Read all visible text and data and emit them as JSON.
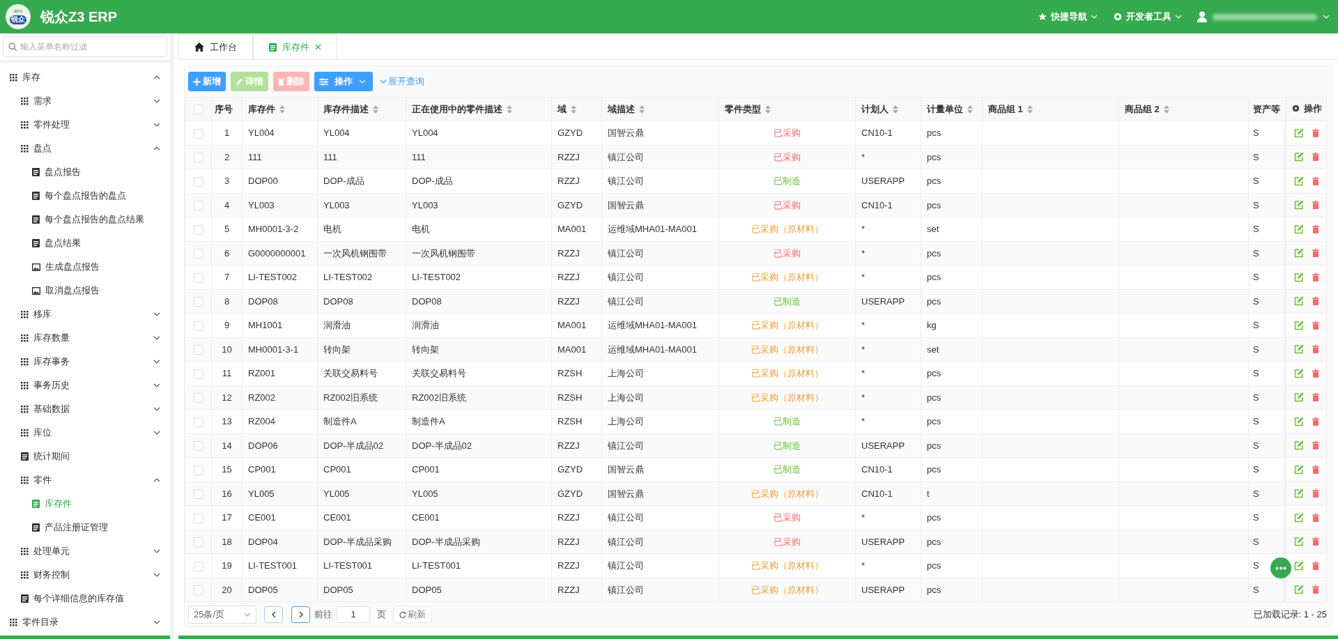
{
  "header": {
    "logo": {
      "top": "RES",
      "bottom": "锐众"
    },
    "title": "锐众Z3 ERP",
    "nav": [
      {
        "kind": "star",
        "label": "快捷导航"
      },
      {
        "kind": "gear",
        "label": "开发者工具"
      }
    ]
  },
  "sidebar": {
    "search": {
      "placeholder": "输入菜单名称过滤"
    },
    "items": [
      {
        "kind": "group",
        "label": "库存",
        "expanded": true,
        "selected": false,
        "children": [
          {
            "kind": "group",
            "label": "需求",
            "expanded": false,
            "selected": false
          },
          {
            "kind": "group",
            "label": "零件处理",
            "expanded": false,
            "selected": false
          },
          {
            "kind": "group",
            "label": "盘点",
            "expanded": true,
            "selected": false,
            "children": [
              {
                "kind": "page",
                "label": "盘点报告",
                "selected": false
              },
              {
                "kind": "page",
                "label": "每个盘点报告的盘点",
                "selected": false
              },
              {
                "kind": "page",
                "label": "每个盘点报告的盘点结果",
                "selected": false
              },
              {
                "kind": "page",
                "label": "盘点结果",
                "selected": false
              },
              {
                "kind": "image",
                "label": "生成盘点报告",
                "selected": false
              },
              {
                "kind": "image",
                "label": "取消盘点报告",
                "selected": false
              }
            ]
          },
          {
            "kind": "group",
            "label": "移库",
            "expanded": false,
            "selected": false
          },
          {
            "kind": "group",
            "label": "库存数量",
            "expanded": false,
            "selected": false
          },
          {
            "kind": "group",
            "label": "库存事务",
            "expanded": false,
            "selected": false
          },
          {
            "kind": "group",
            "label": "事务历史",
            "expanded": false,
            "selected": false
          },
          {
            "kind": "group",
            "label": "基础数据",
            "expanded": false,
            "selected": false
          },
          {
            "kind": "group",
            "label": "库位",
            "expanded": false,
            "selected": false
          },
          {
            "kind": "page",
            "label": "统计期间",
            "selected": false
          },
          {
            "kind": "group",
            "label": "零件",
            "expanded": true,
            "selected": false,
            "children": [
              {
                "kind": "page",
                "label": "库存件",
                "selected": true
              },
              {
                "kind": "page",
                "label": "产品注册证管理",
                "selected": false
              }
            ]
          },
          {
            "kind": "group",
            "label": "处理单元",
            "expanded": false,
            "selected": false
          },
          {
            "kind": "group",
            "label": "财务控制",
            "expanded": false,
            "selected": false
          },
          {
            "kind": "page",
            "label": "每个详细信息的库存值",
            "selected": false
          }
        ]
      },
      {
        "kind": "group",
        "label": "零件目录",
        "expanded": false,
        "selected": false
      }
    ]
  },
  "tabs": [
    {
      "kind": "home",
      "label": "工作台",
      "selected": false,
      "closable": false
    },
    {
      "kind": "page",
      "label": "库存件",
      "selected": true,
      "closable": true
    }
  ],
  "toolbar": {
    "buttons": [
      {
        "kind": "add",
        "label": "新增",
        "disabled": false
      },
      {
        "kind": "edit",
        "label": "详情",
        "disabled": true
      },
      {
        "kind": "delete",
        "label": "删除",
        "disabled": true
      },
      {
        "kind": "menu",
        "label": "操作",
        "disabled": false
      }
    ],
    "expand_link": "展开查询"
  },
  "table": {
    "all_checked": false,
    "columns": [
      {
        "label": "序号",
        "sortable": false
      },
      {
        "label": "库存件",
        "sortable": true
      },
      {
        "label": "库存件描述",
        "sortable": true
      },
      {
        "label": "正在使用中的零件描述",
        "sortable": true
      },
      {
        "label": "域",
        "sortable": true
      },
      {
        "label": "域描述",
        "sortable": true
      },
      {
        "label": "零件类型",
        "sortable": true
      },
      {
        "label": "计划人",
        "sortable": true
      },
      {
        "label": "计量单位",
        "sortable": true
      },
      {
        "label": "商品组 1",
        "sortable": true
      },
      {
        "label": "商品组 2",
        "sortable": true
      },
      {
        "label": "资产等"
      },
      {
        "label": "操作"
      }
    ],
    "rows": [
      {
        "no": "1",
        "part": "YL004",
        "desc": "YL004",
        "in_use": "YL004",
        "domain": "GZYD",
        "domain_desc": "国智云鼎",
        "type": {
          "kind": "purchased",
          "label": "已采购"
        },
        "planner": "CN10-1",
        "unit": "pcs",
        "asset": "S",
        "checked": false
      },
      {
        "no": "2",
        "part": "111",
        "desc": "111",
        "in_use": "111",
        "domain": "RZZJ",
        "domain_desc": "镇江公司",
        "type": {
          "kind": "purchased",
          "label": "已采购"
        },
        "planner": "*",
        "unit": "pcs",
        "asset": "S",
        "checked": false
      },
      {
        "no": "3",
        "part": "DOP00",
        "desc": "DOP-成品",
        "in_use": "DOP-成品",
        "domain": "RZZJ",
        "domain_desc": "镇江公司",
        "type": {
          "kind": "manufactured",
          "label": "已制造"
        },
        "planner": "USERAPP",
        "unit": "pcs",
        "asset": "S",
        "checked": false
      },
      {
        "no": "4",
        "part": "YL003",
        "desc": "YL003",
        "in_use": "YL003",
        "domain": "GZYD",
        "domain_desc": "国智云鼎",
        "type": {
          "kind": "purchased",
          "label": "已采购"
        },
        "planner": "CN10-1",
        "unit": "pcs",
        "asset": "S",
        "checked": false
      },
      {
        "no": "5",
        "part": "MH0001-3-2",
        "desc": "电机",
        "in_use": "电机",
        "domain": "MA001",
        "domain_desc": "运维域MHA01-MA001",
        "type": {
          "kind": "raw",
          "label": "已采购（原材料）"
        },
        "planner": "*",
        "unit": "set",
        "asset": "S",
        "checked": false
      },
      {
        "no": "6",
        "part": "G0000000001",
        "desc": "一次风机钢围带",
        "in_use": "一次风机钢围带",
        "domain": "RZZJ",
        "domain_desc": "镇江公司",
        "type": {
          "kind": "purchased",
          "label": "已采购"
        },
        "planner": "*",
        "unit": "pcs",
        "asset": "S",
        "checked": false
      },
      {
        "no": "7",
        "part": "LI-TEST002",
        "desc": "LI-TEST002",
        "in_use": "LI-TEST002",
        "domain": "RZZJ",
        "domain_desc": "镇江公司",
        "type": {
          "kind": "raw",
          "label": "已采购（原材料）"
        },
        "planner": "*",
        "unit": "pcs",
        "asset": "S",
        "checked": false
      },
      {
        "no": "8",
        "part": "DOP08",
        "desc": "DOP08",
        "in_use": "DOP08",
        "domain": "RZZJ",
        "domain_desc": "镇江公司",
        "type": {
          "kind": "manufactured",
          "label": "已制造"
        },
        "planner": "USERAPP",
        "unit": "pcs",
        "asset": "S",
        "checked": false
      },
      {
        "no": "9",
        "part": "MH1001",
        "desc": "润滑油",
        "in_use": "润滑油",
        "domain": "MA001",
        "domain_desc": "运维域MHA01-MA001",
        "type": {
          "kind": "raw",
          "label": "已采购（原材料）"
        },
        "planner": "*",
        "unit": "kg",
        "asset": "S",
        "checked": false
      },
      {
        "no": "10",
        "part": "MH0001-3-1",
        "desc": "转向架",
        "in_use": "转向架",
        "domain": "MA001",
        "domain_desc": "运维域MHA01-MA001",
        "type": {
          "kind": "raw",
          "label": "已采购（原材料）"
        },
        "planner": "*",
        "unit": "set",
        "asset": "S",
        "checked": false
      },
      {
        "no": "11",
        "part": "RZ001",
        "desc": "关联交易料号",
        "in_use": "关联交易料号",
        "domain": "RZSH",
        "domain_desc": "上海公司",
        "type": {
          "kind": "raw",
          "label": "已采购（原材料）"
        },
        "planner": "*",
        "unit": "pcs",
        "asset": "S",
        "checked": false
      },
      {
        "no": "12",
        "part": "RZ002",
        "desc": "RZ002旧系统",
        "in_use": "RZ002旧系统",
        "domain": "RZSH",
        "domain_desc": "上海公司",
        "type": {
          "kind": "raw",
          "label": "已采购（原材料）"
        },
        "planner": "*",
        "unit": "pcs",
        "asset": "S",
        "checked": false
      },
      {
        "no": "13",
        "part": "RZ004",
        "desc": "制造件A",
        "in_use": "制造件A",
        "domain": "RZSH",
        "domain_desc": "上海公司",
        "type": {
          "kind": "manufactured",
          "label": "已制造"
        },
        "planner": "*",
        "unit": "pcs",
        "asset": "S",
        "checked": false
      },
      {
        "no": "14",
        "part": "DOP06",
        "desc": "DOP-半成品02",
        "in_use": "DOP-半成品02",
        "domain": "RZZJ",
        "domain_desc": "镇江公司",
        "type": {
          "kind": "manufactured",
          "label": "已制造"
        },
        "planner": "USERAPP",
        "unit": "pcs",
        "asset": "S",
        "checked": false
      },
      {
        "no": "15",
        "part": "CP001",
        "desc": "CP001",
        "in_use": "CP001",
        "domain": "GZYD",
        "domain_desc": "国智云鼎",
        "type": {
          "kind": "manufactured",
          "label": "已制造"
        },
        "planner": "CN10-1",
        "unit": "pcs",
        "asset": "S",
        "checked": false
      },
      {
        "no": "16",
        "part": "YL005",
        "desc": "YL005",
        "in_use": "YL005",
        "domain": "GZYD",
        "domain_desc": "国智云鼎",
        "type": {
          "kind": "raw",
          "label": "已采购（原材料）"
        },
        "planner": "CN10-1",
        "unit": "t",
        "asset": "S",
        "checked": false
      },
      {
        "no": "17",
        "part": "CE001",
        "desc": "CE001",
        "in_use": "CE001",
        "domain": "RZZJ",
        "domain_desc": "镇江公司",
        "type": {
          "kind": "purchased",
          "label": "已采购"
        },
        "planner": "*",
        "unit": "pcs",
        "asset": "S",
        "checked": false
      },
      {
        "no": "18",
        "part": "DOP04",
        "desc": "DOP-半成品采购",
        "in_use": "DOP-半成品采购",
        "domain": "RZZJ",
        "domain_desc": "镇江公司",
        "type": {
          "kind": "purchased",
          "label": "已采购"
        },
        "planner": "USERAPP",
        "unit": "pcs",
        "asset": "S",
        "checked": false
      },
      {
        "no": "19",
        "part": "LI-TEST001",
        "desc": "LI-TEST001",
        "in_use": "LI-TEST001",
        "domain": "RZZJ",
        "domain_desc": "镇江公司",
        "type": {
          "kind": "raw",
          "label": "已采购（原材料）"
        },
        "planner": "*",
        "unit": "pcs",
        "asset": "S",
        "checked": false
      },
      {
        "no": "20",
        "part": "DOP05",
        "desc": "DOP05",
        "in_use": "DOP05",
        "domain": "RZZJ",
        "domain_desc": "镇江公司",
        "type": {
          "kind": "raw",
          "label": "已采购（原材料）"
        },
        "planner": "USERAPP",
        "unit": "pcs",
        "asset": "S",
        "checked": false
      }
    ]
  },
  "pagination": {
    "page_size": "25条/页",
    "goto_label": "前往",
    "page": "1",
    "page_suffix": "页",
    "refresh": "刷新",
    "loaded": "已加载记录: 1 - 25"
  }
}
